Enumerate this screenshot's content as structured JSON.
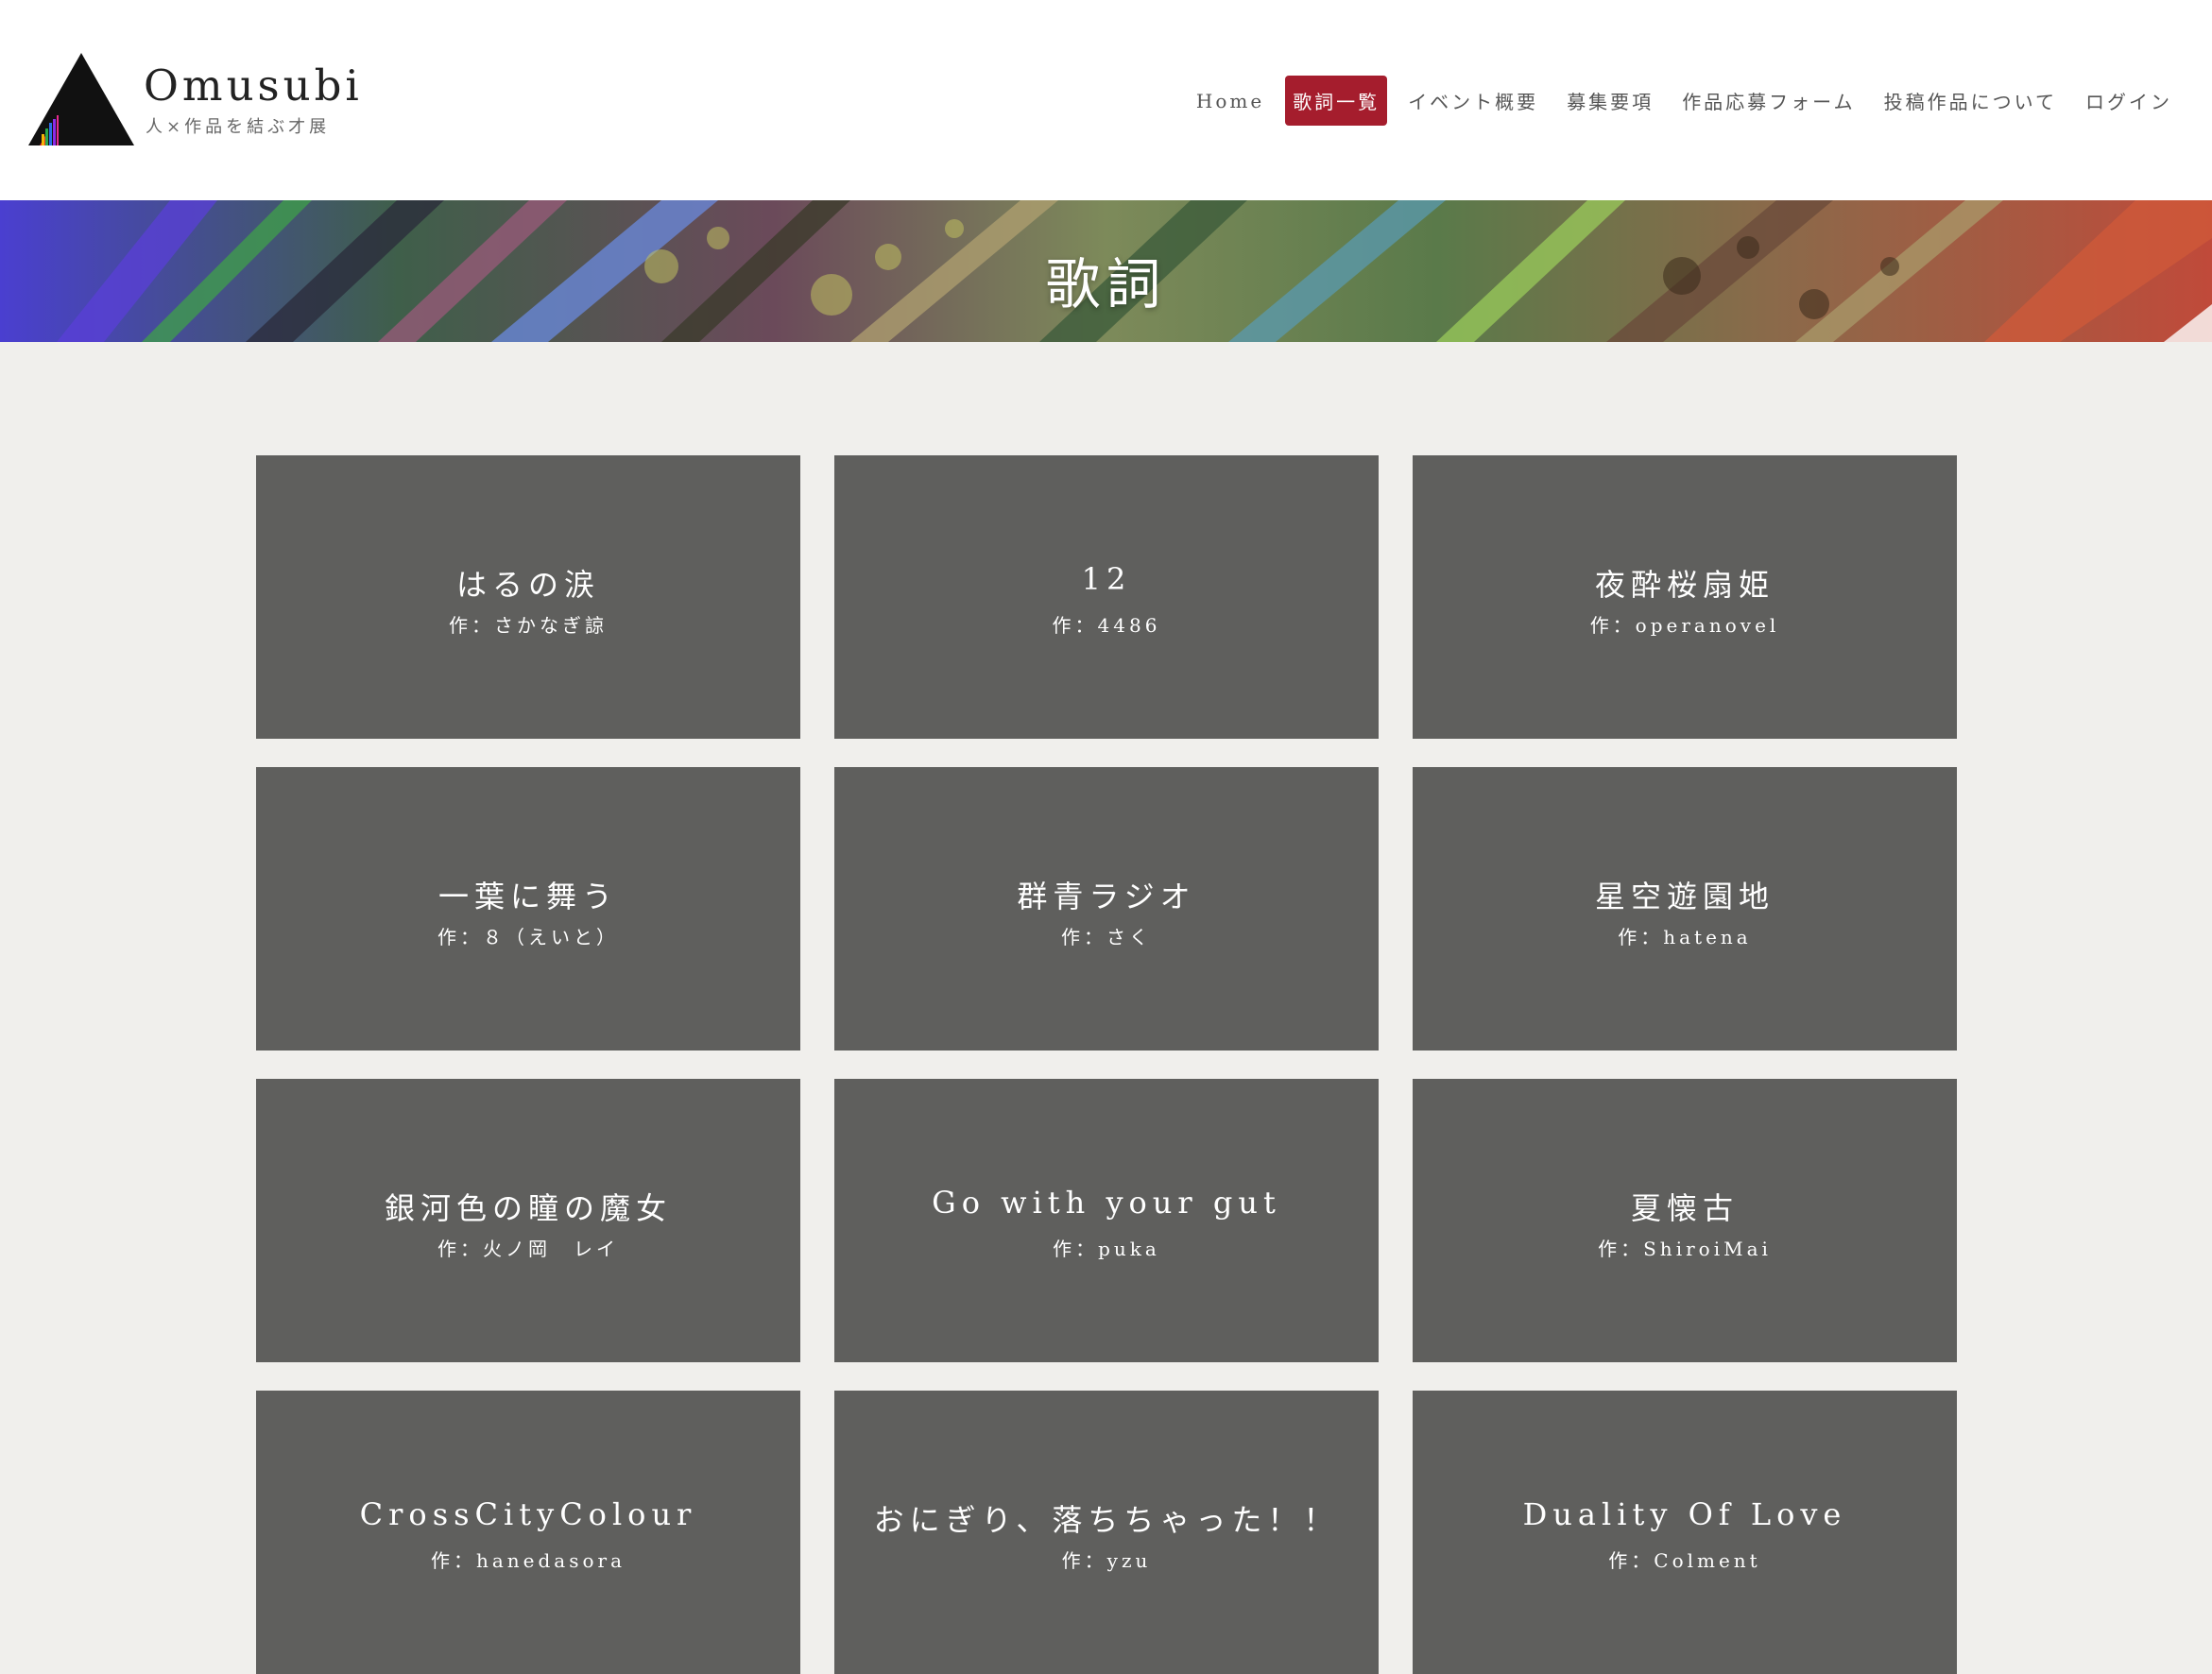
{
  "site": {
    "name": "Omusubi",
    "tagline": "人×作品を結ぶ才展"
  },
  "nav": [
    {
      "label": "Home",
      "active": false
    },
    {
      "label": "歌詞一覧",
      "active": true
    },
    {
      "label": "イベント概要",
      "active": false
    },
    {
      "label": "募集要項",
      "active": false
    },
    {
      "label": "作品応募フォーム",
      "active": false
    },
    {
      "label": "投稿作品について",
      "active": false
    },
    {
      "label": "ログイン",
      "active": false
    }
  ],
  "hero": {
    "title": "歌詞"
  },
  "colors": {
    "accent": "#a51d2d",
    "card_bg": "#5f5f5d",
    "page_bg": "#f0efec"
  },
  "cards": [
    {
      "title": "はるの涙",
      "author": "作：さかなぎ諒"
    },
    {
      "title": "12",
      "author": "作：4486"
    },
    {
      "title": "夜酔桜扇姫",
      "author": "作：operanovel"
    },
    {
      "title": "一葉に舞う",
      "author": "作：８（えいと）"
    },
    {
      "title": "群青ラジオ",
      "author": "作：さく"
    },
    {
      "title": "星空遊園地",
      "author": "作：hatena"
    },
    {
      "title": "銀河色の瞳の魔女",
      "author": "作：火ノ岡　レイ"
    },
    {
      "title": "Go with your gut",
      "author": "作：puka"
    },
    {
      "title": "夏懐古",
      "author": "作：ShiroiMai"
    },
    {
      "title": "CrossCityColour",
      "author": "作：hanedasora"
    },
    {
      "title": "おにぎり、落ちちゃった！！",
      "author": "作：yzu"
    },
    {
      "title": "Duality Of Love",
      "author": "作：Colment"
    }
  ]
}
